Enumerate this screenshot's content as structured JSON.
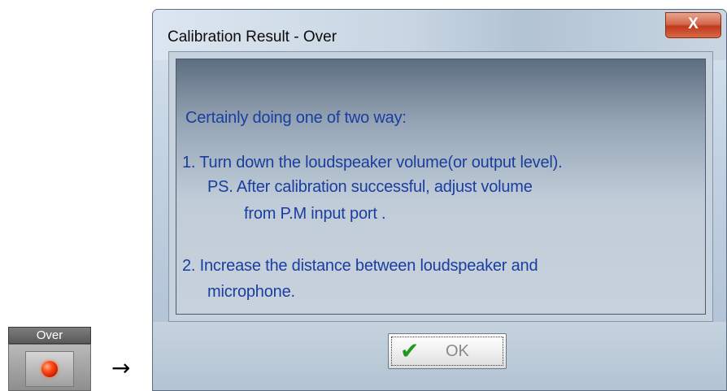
{
  "indicator": {
    "label": "Over",
    "lamp_color": "#ff3a0a"
  },
  "arrow": "→",
  "dialog": {
    "title": "Calibration Result - Over",
    "close_glyph": "X",
    "messages": [
      "Certainly doing one of two way:",
      "1. Turn down the loudspeaker volume(or output level).",
      "PS. After calibration successful, adjust volume",
      "from P.M input port .",
      "2. Increase the distance between loudspeaker and",
      "microphone."
    ],
    "ok_button": {
      "label": "OK",
      "icon": "checkmark-icon",
      "icon_glyph": "✔"
    }
  },
  "colors": {
    "message_text": "#1a3ea0",
    "close_button": "#c1391c",
    "checkmark": "#1f9a1f"
  }
}
